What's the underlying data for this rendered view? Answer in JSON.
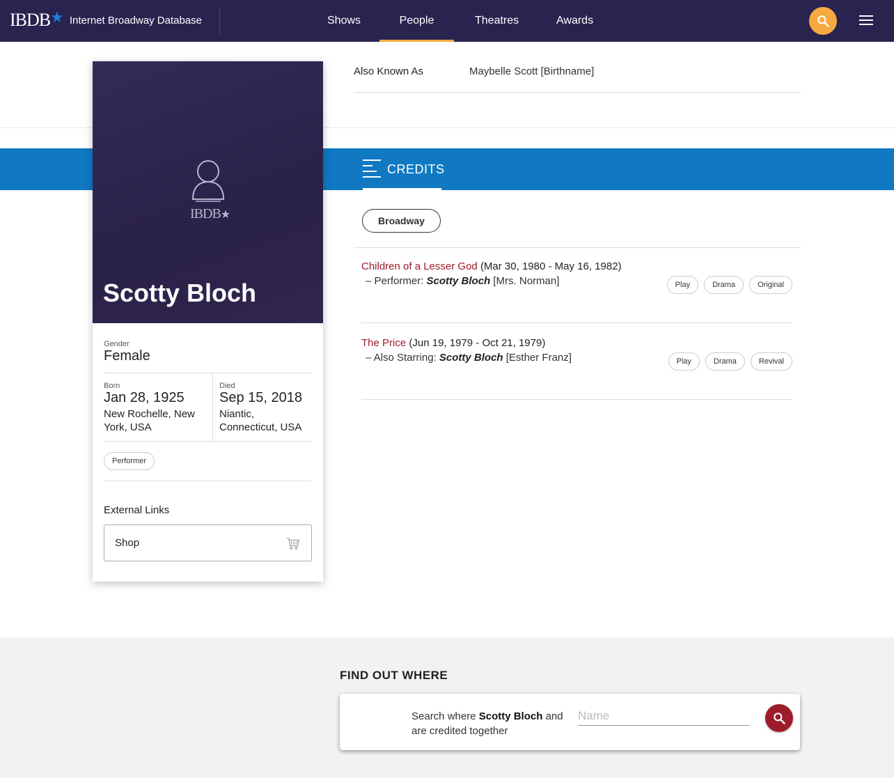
{
  "nav": {
    "brand_logo": "IBDB",
    "brand_name": "Internet Broadway Database",
    "links": [
      "Shows",
      "People",
      "Theatres",
      "Awards"
    ],
    "active": "People",
    "search_icon": "search-icon",
    "menu_icon": "hamburger-menu-icon"
  },
  "person": {
    "name": "Scotty Bloch",
    "hero_logo": "IBDB",
    "gender_label": "Gender",
    "gender": "Female",
    "born_label": "Born",
    "born_date": "Jan 28, 1925",
    "born_place": "New Rochelle, New York, USA",
    "died_label": "Died",
    "died_date": "Sep 15, 2018",
    "died_place": "Niantic, Connecticut, USA",
    "role": "Performer",
    "external_links_label": "External Links",
    "shop_label": "Shop"
  },
  "aka": {
    "label": "Also Known As",
    "value": "Maybelle Scott [Birthname]"
  },
  "credits": {
    "tab_label": "CREDITS",
    "filter": "Broadway",
    "items": [
      {
        "show": "Children of a Lesser God",
        "dates": "(Mar 30, 1980 - May 16, 1982)",
        "role_prefix": "– Performer:",
        "person": "Scotty Bloch",
        "character": "[Mrs. Norman]",
        "tags": [
          "Play",
          "Drama",
          "Original"
        ]
      },
      {
        "show": "The Price",
        "dates": "(Jun 19, 1979 - Oct 21, 1979)",
        "role_prefix": "– Also Starring:",
        "person": "Scotty Bloch",
        "character": "[Esther Franz]",
        "tags": [
          "Play",
          "Drama",
          "Revival"
        ]
      }
    ]
  },
  "find": {
    "heading": "FIND OUT WHERE",
    "text_before": "Search where ",
    "person": "Scotty Bloch",
    "text_after": " and are credited together",
    "placeholder": "Name"
  },
  "colors": {
    "nav_bg": "#28234f",
    "accent_orange": "#f7a941",
    "credits_blue": "#1079c2",
    "show_link": "#9d1c2b"
  }
}
